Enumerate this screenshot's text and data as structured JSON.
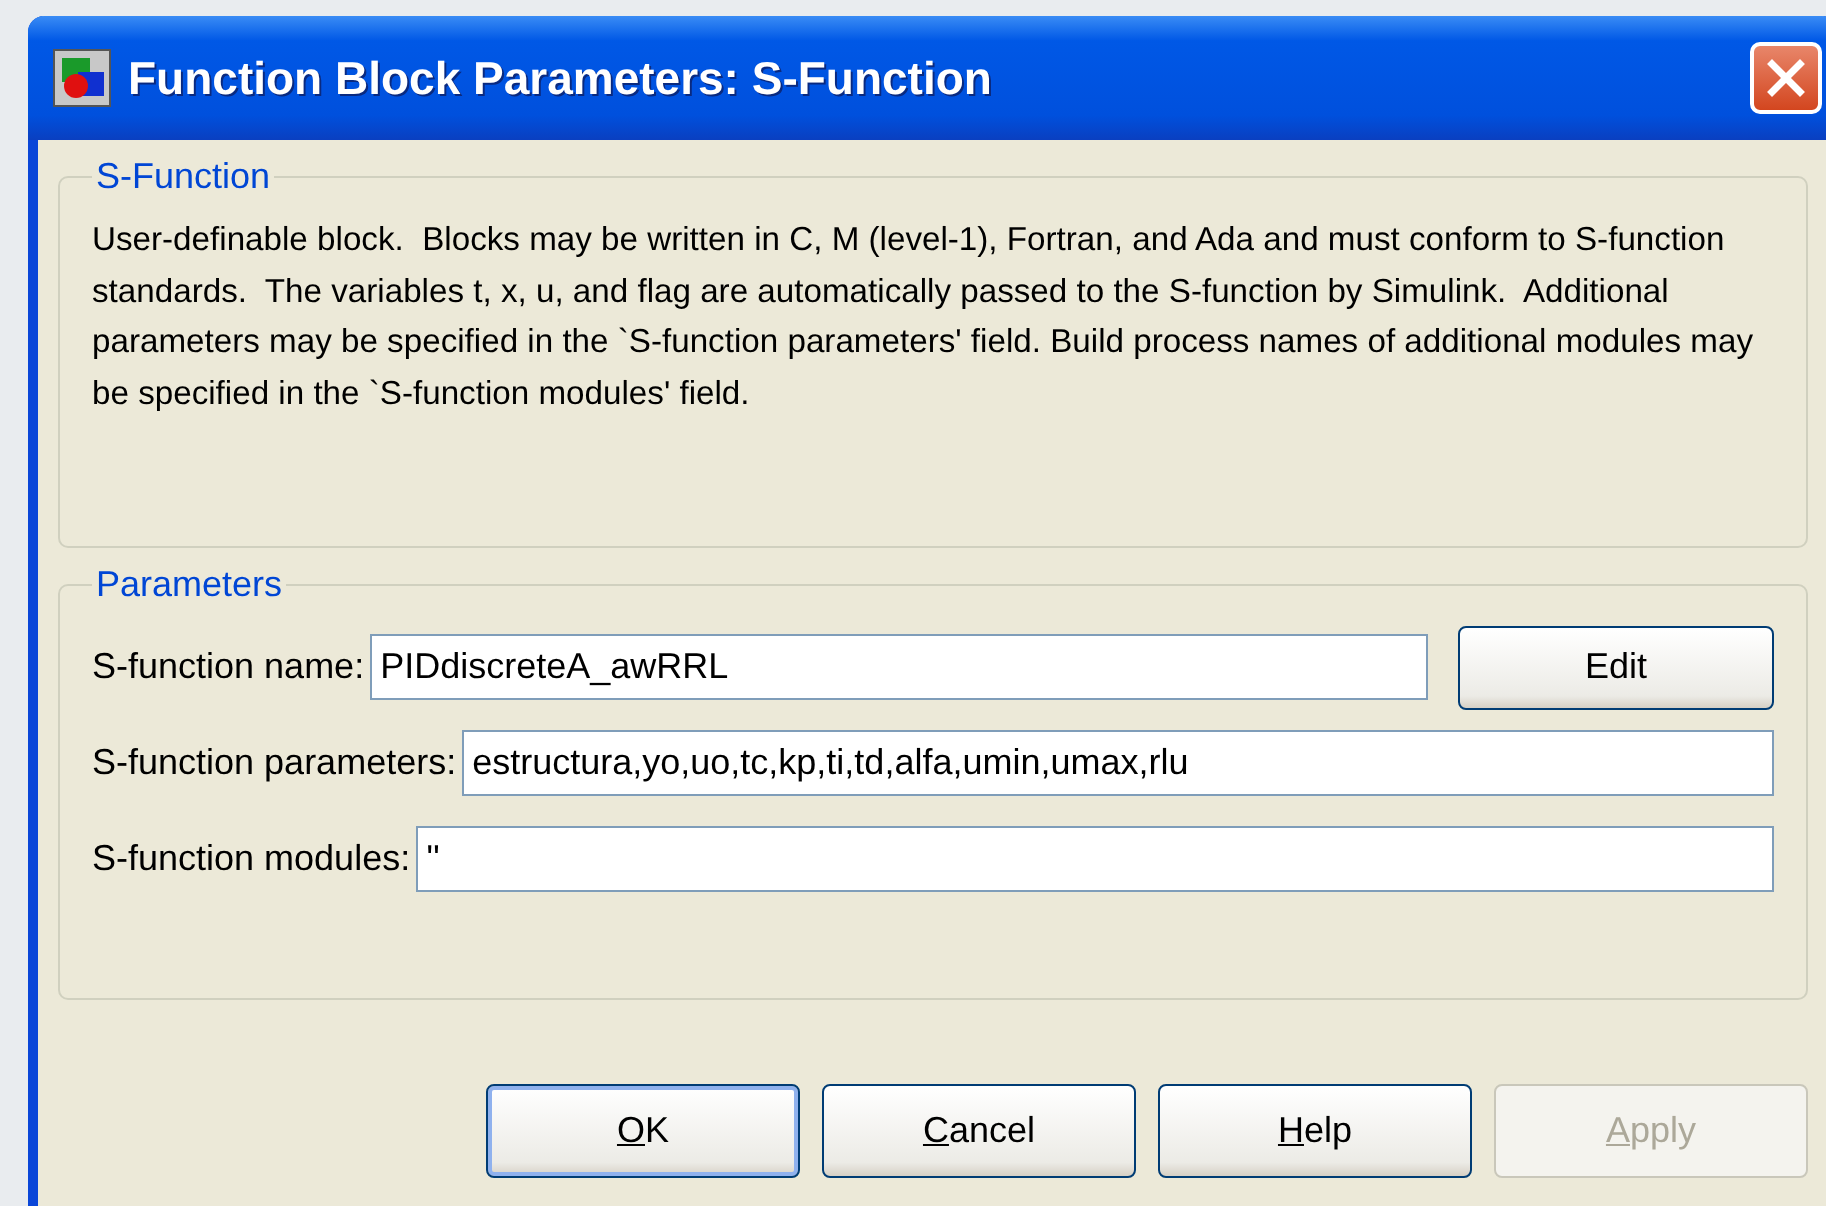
{
  "window": {
    "title": "Function Block Parameters: S-Function"
  },
  "description_group": {
    "title": "S-Function",
    "text": "User-definable block.  Blocks may be written in C, M (level-1), Fortran, and Ada and must conform to S-function standards.  The variables t, x, u, and flag are automatically passed to the S-function by Simulink.  Additional parameters may be specified in the `S-function parameters' field. Build process names of additional modules may be specified in the `S-function modules' field."
  },
  "parameters_group": {
    "title": "Parameters",
    "fields": [
      {
        "label": "S-function name:",
        "value": "PIDdiscreteA_awRRL",
        "edit_button": "Edit"
      },
      {
        "label": "S-function parameters:",
        "value": "estructura,yo,uo,tc,kp,ti,td,alfa,umin,umax,rlu"
      },
      {
        "label": "S-function modules:",
        "value": "''"
      }
    ]
  },
  "buttons": [
    {
      "label": "OK",
      "underline_first": true,
      "default": true,
      "disabled": false
    },
    {
      "label": "Cancel",
      "underline_first": true,
      "default": false,
      "disabled": false
    },
    {
      "label": "Help",
      "underline_first": true,
      "default": false,
      "disabled": false
    },
    {
      "label": "Apply",
      "underline_first": true,
      "default": false,
      "disabled": true
    }
  ]
}
